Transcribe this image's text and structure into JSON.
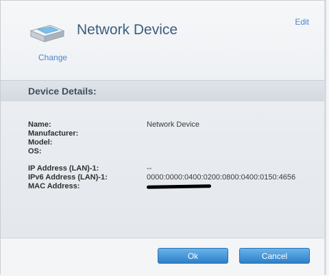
{
  "header": {
    "title": "Network Device",
    "edit_label": "Edit",
    "change_label": "Change",
    "icon": "network-device-icon"
  },
  "details": {
    "section_title": "Device Details:",
    "fields": [
      {
        "label": "Name:",
        "value": "Network Device"
      },
      {
        "label": "Manufacturer:",
        "value": ""
      },
      {
        "label": "Model:",
        "value": ""
      },
      {
        "label": "OS:",
        "value": ""
      },
      {
        "label": "IP Address (LAN)-1:",
        "value": "--"
      },
      {
        "label": "IPv6 Address (LAN)-1:",
        "value": "0000:0000:0400:0200:0800:0400:0150:4656"
      },
      {
        "label": "MAC Address:",
        "value": "[redacted]"
      }
    ]
  },
  "footer": {
    "ok_label": "Ok",
    "cancel_label": "Cancel"
  },
  "colors": {
    "link": "#4a86c5",
    "title": "#3c5d7c",
    "button_top": "#6ab3ea",
    "button_bottom": "#2d7fc7"
  }
}
